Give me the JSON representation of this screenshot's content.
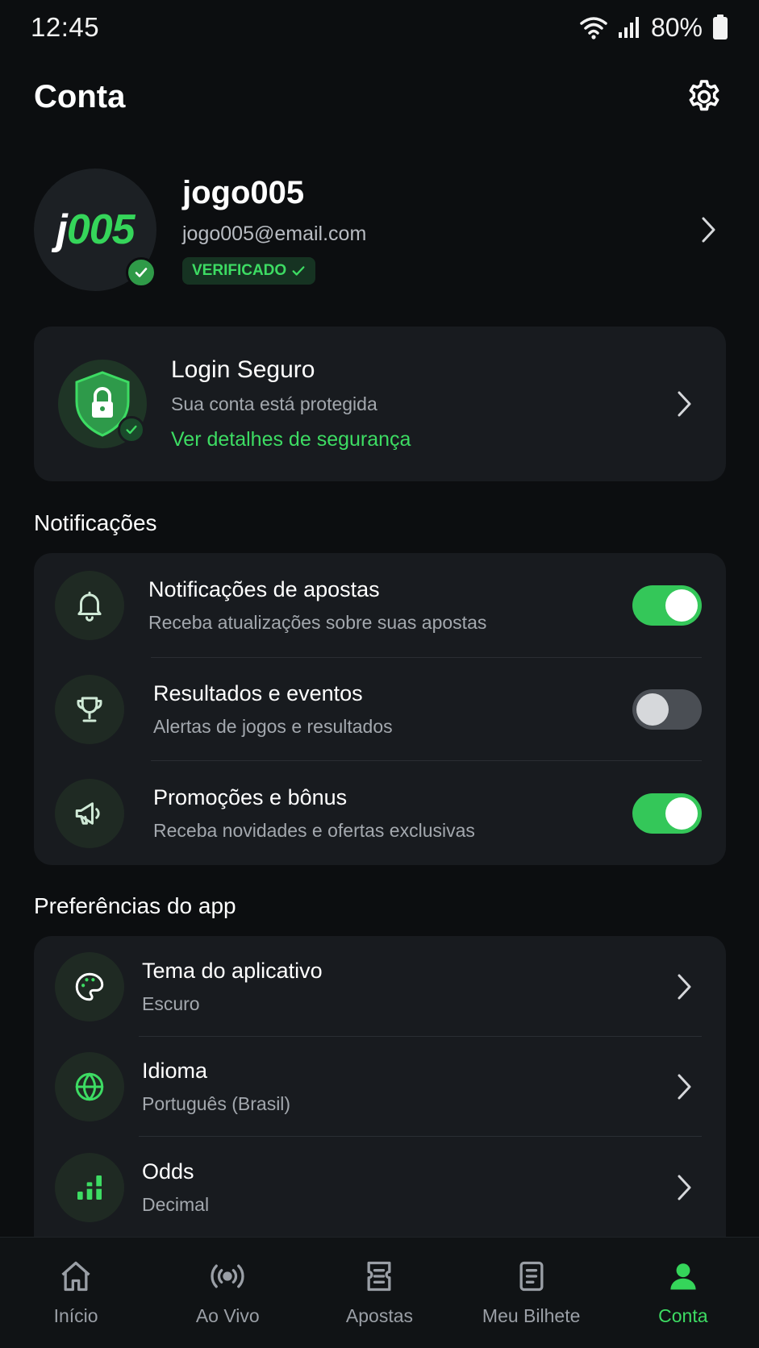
{
  "status_bar": {
    "time": "12:45",
    "battery": "80%",
    "icons": [
      "wifi-icon",
      "signal-icon",
      "battery-icon"
    ]
  },
  "header": {
    "title": "Conta",
    "settings_icon": "gear-icon"
  },
  "profile": {
    "avatar_text_white": "j",
    "avatar_text_green": "005",
    "username": "jogo005",
    "email": "jogo005@email.com",
    "badge": "VERIFICADO"
  },
  "security": {
    "title": "Login Seguro",
    "subtitle": "Sua conta está protegida",
    "link": "Ver detalhes de segurança"
  },
  "notifications": {
    "section_title": "Notificações",
    "items": [
      {
        "title": "Notificações de apostas",
        "subtitle": "Receba atualizações sobre suas apostas",
        "icon": "bell-icon",
        "enabled": true
      },
      {
        "title": "Resultados e eventos",
        "subtitle": "Alertas de jogos e resultados",
        "icon": "trophy-icon",
        "enabled": false
      },
      {
        "title": "Promoções e bônus",
        "subtitle": "Receba novidades e ofertas exclusivas",
        "icon": "megaphone-icon",
        "enabled": true
      }
    ]
  },
  "preferences": {
    "section_title": "Preferências do app",
    "items": [
      {
        "title": "Tema do aplicativo",
        "value": "Escuro",
        "icon": "palette-icon"
      },
      {
        "title": "Idioma",
        "value": "Português (Brasil)",
        "icon": "globe-icon"
      },
      {
        "title": "Odds",
        "value": "Decimal",
        "icon": "bar-chart-icon"
      }
    ]
  },
  "bottom_nav": {
    "items": [
      {
        "label": "Início",
        "icon": "home-icon",
        "active": false
      },
      {
        "label": "Ao Vivo",
        "icon": "live-broadcast-icon",
        "active": false
      },
      {
        "label": "Apostas",
        "icon": "ticket-icon",
        "active": false
      },
      {
        "label": "Meu Bilhete",
        "icon": "document-icon",
        "active": false
      },
      {
        "label": "Conta",
        "icon": "user-icon",
        "active": true
      }
    ]
  },
  "colors": {
    "accent": "#35d55a",
    "background": "#0c0e10",
    "card": "#181b1f",
    "muted_text": "#a3a8ae"
  }
}
